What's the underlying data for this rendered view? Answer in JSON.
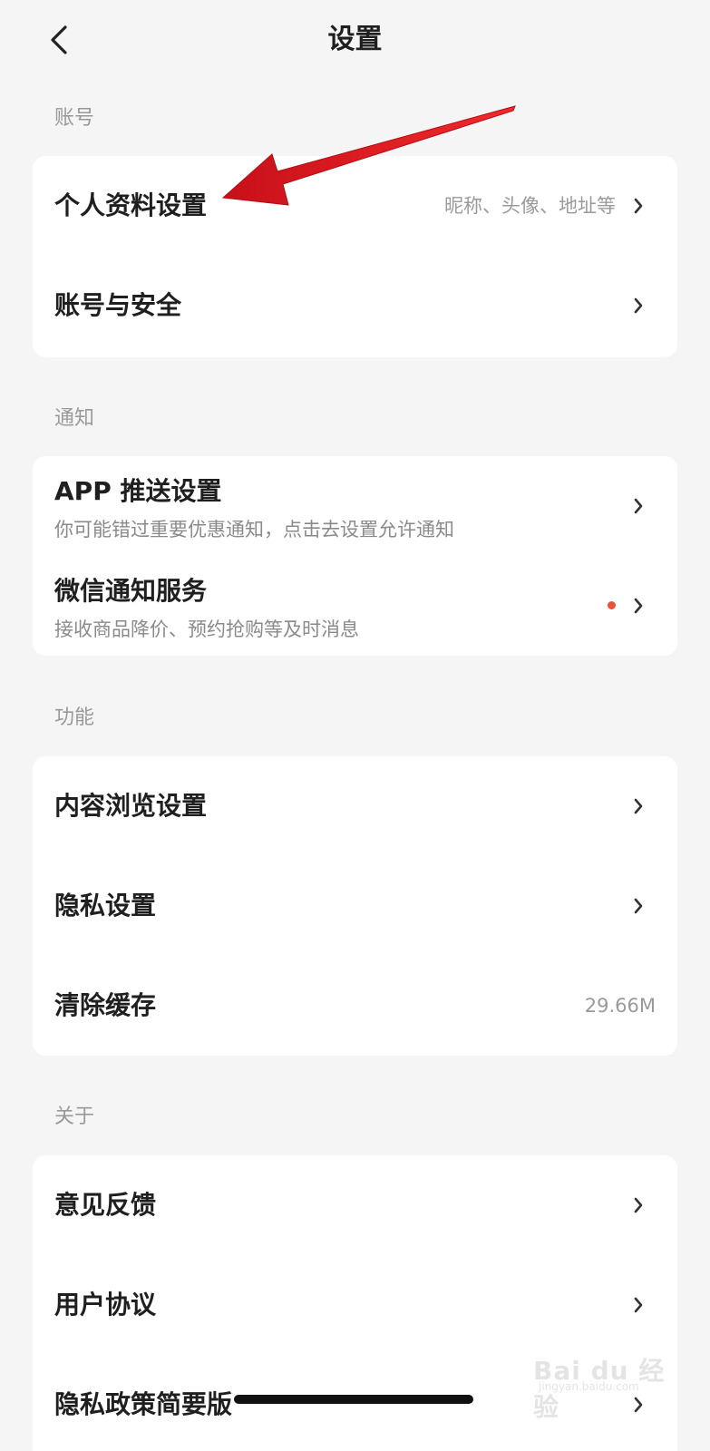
{
  "header": {
    "title": "设置",
    "back_icon": "chevron-left-icon"
  },
  "sections": {
    "account": {
      "label": "账号",
      "items": [
        {
          "title": "个人资料设置",
          "value": "昵称、头像、地址等"
        },
        {
          "title": "账号与安全"
        }
      ]
    },
    "notification": {
      "label": "通知",
      "items": [
        {
          "title": "APP 推送设置",
          "subtitle": "你可能错过重要优惠通知，点击去设置允许通知"
        },
        {
          "title": "微信通知服务",
          "subtitle": "接收商品降价、预约抢购等及时消息",
          "badge_color": "#e8523a"
        }
      ]
    },
    "function": {
      "label": "功能",
      "items": [
        {
          "title": "内容浏览设置"
        },
        {
          "title": "隐私设置"
        },
        {
          "title": "清除缓存",
          "value": "29.66M"
        }
      ]
    },
    "about": {
      "label": "关于",
      "items": [
        {
          "title": "意见反馈"
        },
        {
          "title": "用户协议"
        },
        {
          "title": "隐私政策简要版"
        }
      ]
    }
  },
  "annotation": {
    "arrow_color": "#e8141c",
    "arrow_icon": "red-arrow-pointer-icon"
  },
  "watermark": {
    "brand": "Bai du 经验",
    "url": "jingyan.baidu.com"
  },
  "colors": {
    "background": "#f5f5f5",
    "card": "#ffffff",
    "text_primary": "#1f1f1f",
    "text_secondary": "#9a9a9a",
    "accent_dot": "#e8523a"
  }
}
